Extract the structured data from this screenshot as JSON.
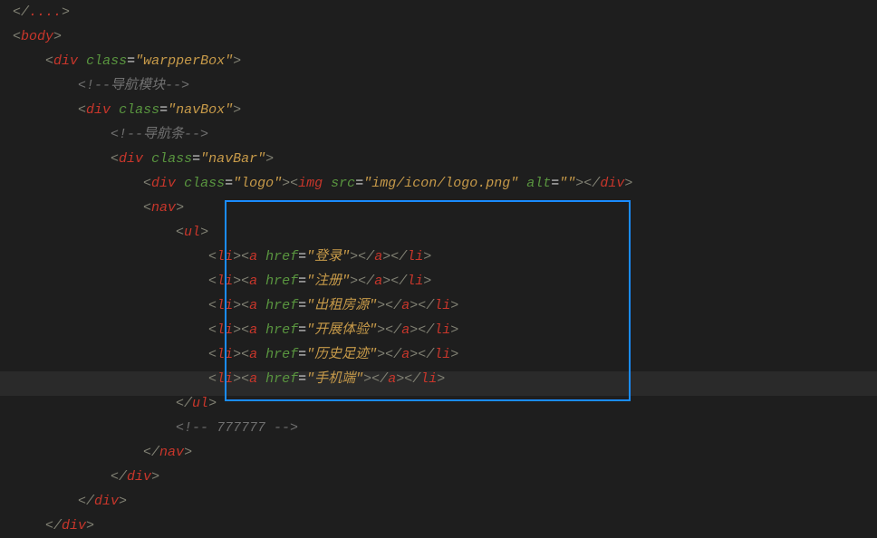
{
  "code": {
    "tag_head_partial": "",
    "tag_body": "body",
    "tag_div": "div",
    "tag_nav": "nav",
    "tag_img": "img",
    "tag_ul": "ul",
    "tag_li": "li",
    "tag_a": "a",
    "attr_class": "class",
    "attr_src": "src",
    "attr_alt": "alt",
    "attr_href": "href",
    "val_warpperBox": "\"warpperBox\"",
    "val_navBox": "\"navBox\"",
    "val_navBar": "\"navBar\"",
    "val_logo": "\"logo\"",
    "val_imgsrc": "\"img/icon/logo.png\"",
    "val_alt": "\"\"",
    "comment_navmod": "<!--导航模块-->",
    "comment_navbar": "<!--导航条-->",
    "comment_777": "<!-- 777777 -->",
    "href_login": "\"登录\"",
    "href_register": "\"注册\"",
    "href_rent": "\"出租房源\"",
    "href_exp": "\"开展体验\"",
    "href_history": "\"历史足迹\"",
    "href_mobile": "\"手机端\""
  }
}
